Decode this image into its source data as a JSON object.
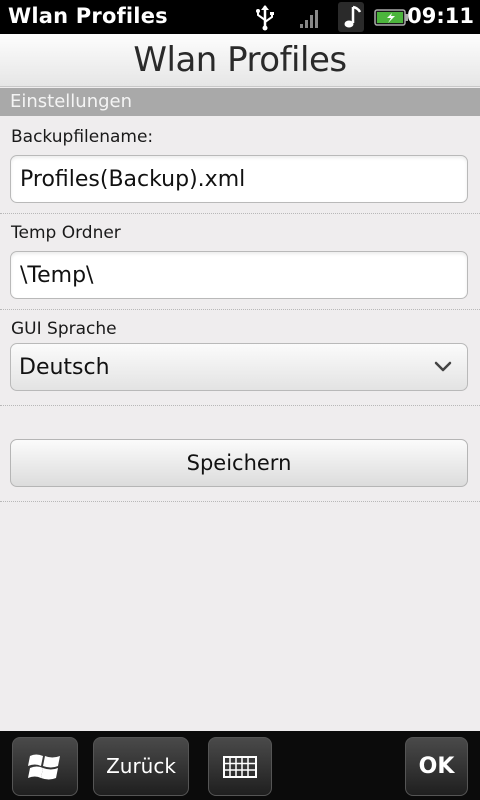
{
  "status_bar": {
    "app_title": "Wlan Profiles",
    "time": "09:11",
    "icons": [
      "usb-icon",
      "signal-icon",
      "music-icon",
      "battery-icon"
    ]
  },
  "header": {
    "title": "Wlan Profiles"
  },
  "section": {
    "title": "Einstellungen"
  },
  "form": {
    "backup_label": "Backupfilename:",
    "backup_value": "Profiles(Backup).xml",
    "temp_label": "Temp Ordner",
    "temp_value": "\\Temp\\",
    "lang_label": "GUI Sprache",
    "lang_value": "Deutsch",
    "save_label": "Speichern"
  },
  "bottom_bar": {
    "back_label": "Zurück",
    "ok_label": "OK",
    "icons": [
      "windows-icon",
      "keyboard-icon"
    ]
  },
  "colors": {
    "background": "#efedee",
    "section_header": "#a9a9a9",
    "status_bar": "#000000",
    "bottom_bar": "#0b0b0b"
  }
}
